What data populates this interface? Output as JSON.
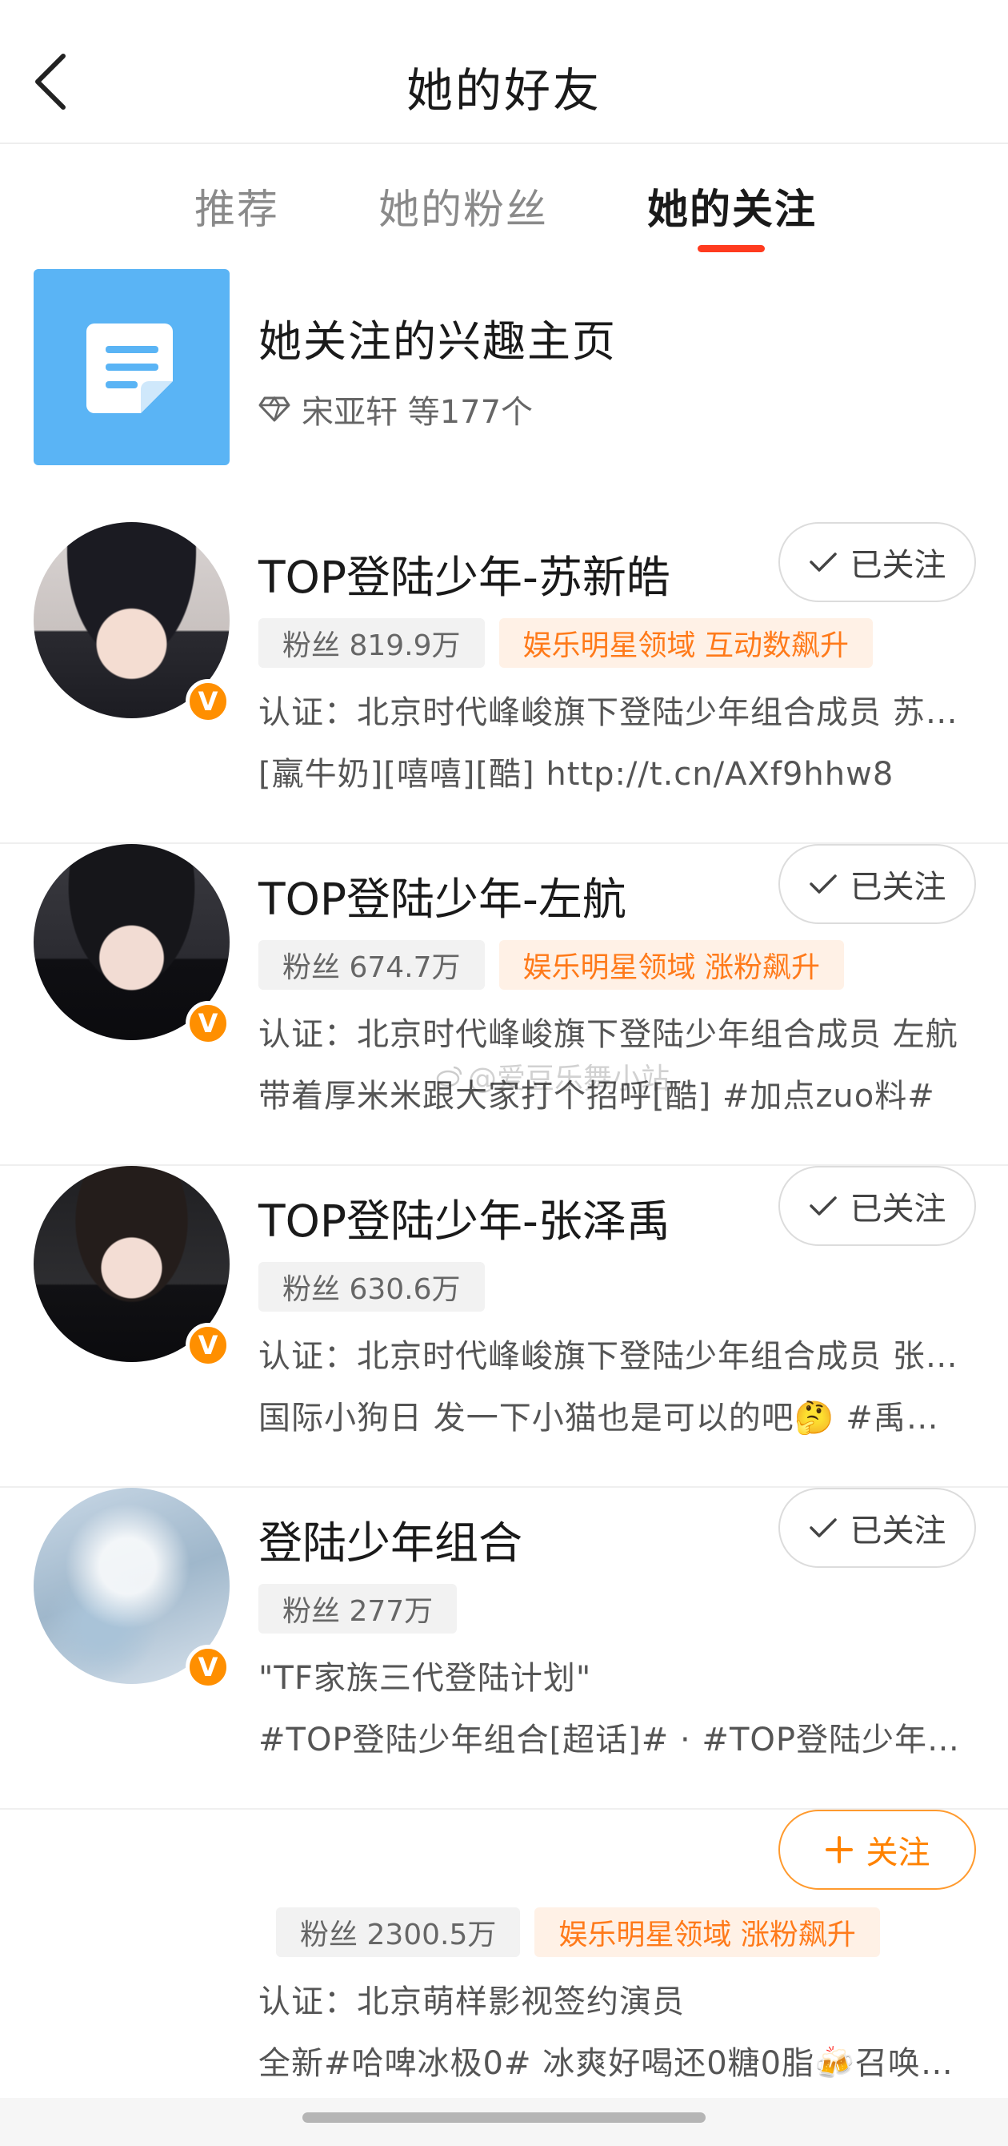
{
  "header": {
    "title": "她的好友",
    "back_icon": "chevron-left-icon"
  },
  "tabs": [
    {
      "label": "推荐",
      "active": false
    },
    {
      "label": "她的粉丝",
      "active": false
    },
    {
      "label": "她的关注",
      "active": true
    }
  ],
  "interest": {
    "title": "她关注的兴趣主页",
    "subtitle": "宋亚轩 等177个",
    "icon": "document-icon"
  },
  "users": [
    {
      "name": "TOP登陆少年-苏新皓",
      "follow_label": "已关注",
      "fans": "粉丝 819.9万",
      "badge": "娱乐明星领域 互动数飙升",
      "line1": "认证：北京时代峰峻旗下登陆少年组合成员 苏…",
      "line2": "[羸牛奶][嘻嘻][酷] http://t.cn/AXf9hhw8"
    },
    {
      "name": "TOP登陆少年-左航",
      "follow_label": "已关注",
      "fans": "粉丝 674.7万",
      "badge": "娱乐明星领域 涨粉飙升",
      "line1": "认证：北京时代峰峻旗下登陆少年组合成员 左航",
      "line2": "带着厚米米跟大家打个招呼[酷] #加点zuo料#"
    },
    {
      "name": "TOP登陆少年-张泽禹",
      "follow_label": "已关注",
      "fans": "粉丝 630.6万",
      "badge": "",
      "line1": "认证：北京时代峰峻旗下登陆少年组合成员 张…",
      "line2": "国际小狗日 发一下小猫也是可以的吧🤔 #禹…"
    },
    {
      "name": "登陆少年组合",
      "follow_label": "已关注",
      "fans": "粉丝 277万",
      "badge": "",
      "line1": "\"TF家族三代登陆计划\"",
      "line2": "#TOP登陆少年组合[超话]# · #TOP登陆少年…"
    },
    {
      "name": "",
      "follow_label": "关注",
      "fans": "粉丝 2300.5万",
      "badge": "娱乐明星领域 涨粉飙升",
      "line1": "认证：北京萌样影视签约演员",
      "line2": "全新#哈啤冰极0# 冰爽好喝还0糖0脂🍻召唤…"
    }
  ],
  "watermark": "@爱豆乐舞小站",
  "colors": {
    "accent": "#ff3b1f",
    "orange": "#ff8200",
    "interest_bg": "#5ab4f5"
  }
}
